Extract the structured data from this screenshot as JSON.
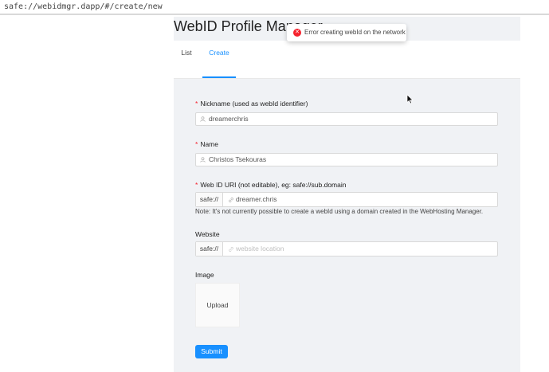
{
  "browser": {
    "url": "safe://webidmgr.dapp/#/create/new"
  },
  "app": {
    "title": "WebID Profile Manager"
  },
  "tabs": [
    {
      "label": "List",
      "active": false
    },
    {
      "label": "Create",
      "active": true
    }
  ],
  "form": {
    "required_mark": "*",
    "nickname": {
      "label": "Nickname (used as webId identifier)",
      "value": "dreamerchris",
      "icon": "user-icon"
    },
    "name": {
      "label": "Name",
      "value": "Christos Tsekouras",
      "icon": "user-icon"
    },
    "webid_uri": {
      "label": "Web ID URI (not editable), eg: safe://sub.domain",
      "prefix": "safe://",
      "value": "dreamer.chris",
      "icon": "link-icon",
      "note": "Note: It's not currently possible to create a webId using a domain created in the WebHosting Manager."
    },
    "website": {
      "label": "Website",
      "prefix": "safe://",
      "placeholder": "website location",
      "icon": "link-icon"
    },
    "image": {
      "label": "Image",
      "upload_label": "Upload"
    },
    "submit_label": "Submit"
  },
  "notification": {
    "type": "error",
    "icon": "error-circle-icon",
    "message": "Error creating webId on the network"
  },
  "colors": {
    "primary": "#1890ff",
    "error": "#f5222d",
    "content_bg": "#f0f2f5"
  }
}
